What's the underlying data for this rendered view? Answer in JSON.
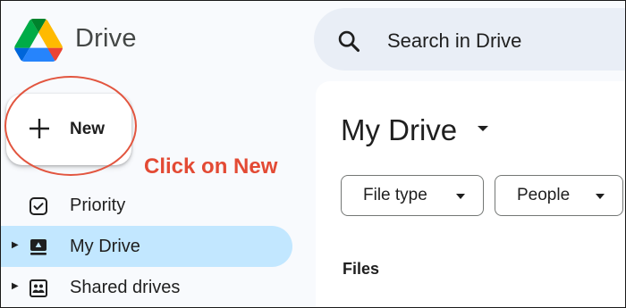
{
  "header": {
    "app_name": "Drive",
    "search_placeholder": "Search in Drive"
  },
  "new_button": {
    "label": "New"
  },
  "annotation": {
    "text": "Click on New",
    "color": "#e34a34"
  },
  "sidebar": {
    "items": [
      {
        "label": "Priority",
        "icon": "priority-checkbox-icon",
        "active": false,
        "has_caret": false
      },
      {
        "label": "My Drive",
        "icon": "my-drive-icon",
        "active": true,
        "has_caret": true
      },
      {
        "label": "Shared drives",
        "icon": "shared-drives-icon",
        "active": false,
        "has_caret": true
      }
    ]
  },
  "main": {
    "title": "My Drive",
    "filters": [
      {
        "label": "File type"
      },
      {
        "label": "People"
      }
    ],
    "section_heading": "Files"
  },
  "colors": {
    "accent_selected": "#c2e7ff",
    "search_bg": "#e9eef6",
    "page_bg": "#f8fafd"
  }
}
